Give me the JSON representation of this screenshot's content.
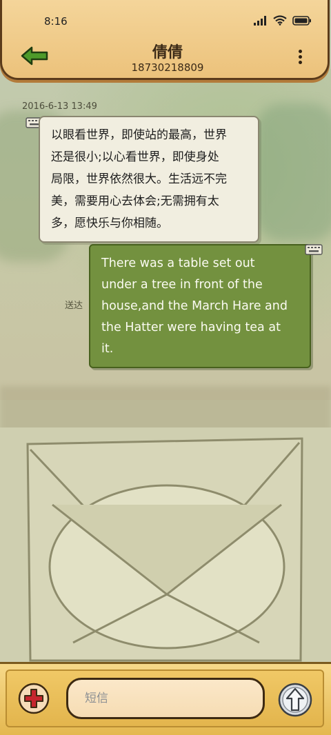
{
  "status_bar": {
    "time": "8:16",
    "icons": [
      "signal-icon",
      "wifi-icon",
      "battery-icon"
    ]
  },
  "header": {
    "contact_name": "倩倩",
    "contact_number": "18730218809",
    "back_icon": "back-arrow-icon",
    "more_icon": "more-vertical-icon"
  },
  "conversation": {
    "timestamp": "2016-6-13 13:49",
    "messages": [
      {
        "direction": "incoming",
        "lines": [
          "以眼看世界，即使站的最高，世界",
          "还是很小;以心看世界，即使身处",
          "局限，世界依然很大。生活远不完",
          "美，需要用心去体会;无需拥有太",
          "多，愿快乐与你相随。"
        ]
      },
      {
        "direction": "outgoing",
        "status": "送达",
        "lines": [
          "There was a table set out",
          "under a tree in front of the",
          "house,and the March Hare and",
          "the Hatter were having tea at",
          "it."
        ]
      }
    ]
  },
  "input_bar": {
    "placeholder": "短信",
    "add_icon": "plus-icon",
    "send_icon": "send-arrow-icon"
  },
  "colors": {
    "header_bg": "#f0c985",
    "incoming_bubble": "#f1eee0",
    "outgoing_bubble": "#73913f",
    "back_arrow": "#4e9a2a",
    "add_button": "#c6262e"
  }
}
